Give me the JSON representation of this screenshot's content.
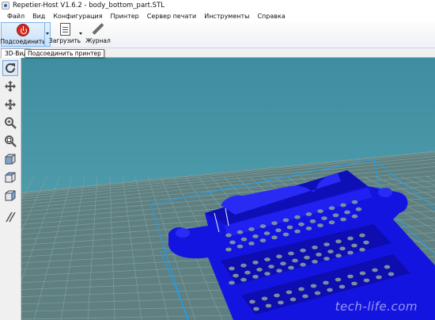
{
  "window": {
    "title": "Repetier-Host V1.6.2 - body_bottom_part.STL"
  },
  "menu": {
    "items": [
      {
        "label": "Файл"
      },
      {
        "label": "Вид"
      },
      {
        "label": "Конфигурация"
      },
      {
        "label": "Принтер"
      },
      {
        "label": "Сервер печати"
      },
      {
        "label": "Инструменты"
      },
      {
        "label": "Справка"
      }
    ]
  },
  "toolbar": {
    "connect_label": "Подсоединить",
    "load_label": "Загрузить",
    "log_label": "Журнал",
    "icons": {
      "connect": "power-icon",
      "load": "document-icon",
      "log": "pen-icon"
    }
  },
  "tabs": {
    "view_3d": "3D-Вид"
  },
  "tooltip": {
    "text": "Подсоединить принтер"
  },
  "tools": [
    {
      "name": "refresh-icon"
    },
    {
      "name": "move-icon"
    },
    {
      "name": "pan-icon"
    },
    {
      "name": "zoom-in-icon"
    },
    {
      "name": "zoom-fit-icon"
    },
    {
      "name": "view-iso-icon"
    },
    {
      "name": "view-front-icon"
    },
    {
      "name": "view-top-icon"
    },
    {
      "name": "parallel-icon"
    }
  ],
  "viewport": {
    "watermark": "tech-life.com",
    "colors": {
      "sky": "#3f8fa2",
      "floor": "#5e7f7f",
      "grid": "#7ea0a0",
      "model": "#1515e6",
      "bbox": "#1aa0f0"
    }
  }
}
